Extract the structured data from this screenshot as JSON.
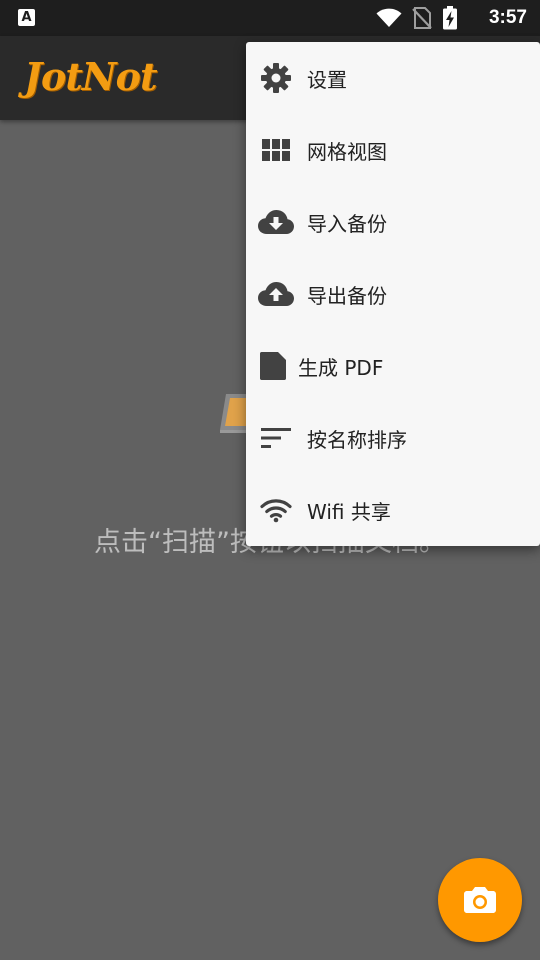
{
  "status_bar": {
    "notification_glyph": "A",
    "time": "3:57",
    "icons": [
      "wifi-icon",
      "no-sim-icon",
      "battery-charging-icon"
    ]
  },
  "app_bar": {
    "logo_text": "JotNot"
  },
  "empty_state": {
    "hint": "点击“扫描”按钮以扫描文档。"
  },
  "menu": {
    "items": [
      {
        "label": "设置",
        "icon": "gear-icon"
      },
      {
        "label": "网格视图",
        "icon": "grid-icon"
      },
      {
        "label": "导入备份",
        "icon": "cloud-download-icon"
      },
      {
        "label": "导出备份",
        "icon": "cloud-upload-icon"
      },
      {
        "label": "生成 PDF",
        "icon": "document-icon"
      },
      {
        "label": "按名称排序",
        "icon": "sort-icon"
      },
      {
        "label": "Wifi 共享",
        "icon": "wifi-icon"
      }
    ]
  },
  "fab": {
    "icon": "camera-icon"
  },
  "colors": {
    "accent": "#ff9800",
    "logo": "#f39c12",
    "background": "#616161",
    "app_bar": "#2a2a2a",
    "status_bar": "#1e1e1e",
    "menu_bg": "#f7f7f7",
    "menu_icon": "#424242"
  }
}
